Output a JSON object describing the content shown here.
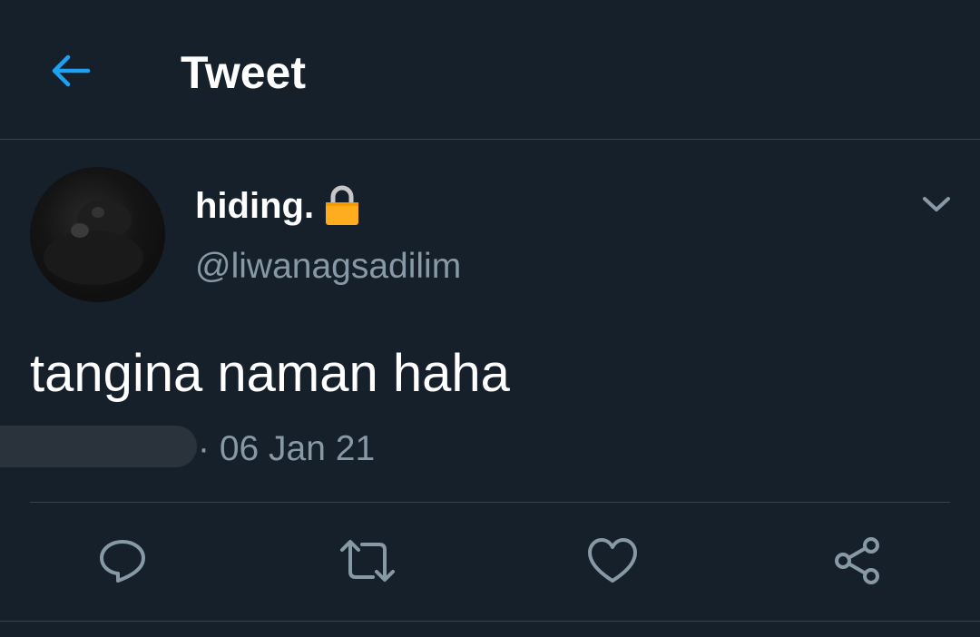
{
  "header": {
    "title": "Tweet",
    "back_icon": "arrow-left-icon"
  },
  "author": {
    "display_name": "hiding.",
    "handle": "@liwanagsadilim",
    "protected_icon": "lock-icon"
  },
  "tweet": {
    "text": "tangina naman haha",
    "timestamp": "· 06 Jan 21"
  },
  "actions": [
    {
      "name": "reply",
      "icon": "reply-icon"
    },
    {
      "name": "retweet",
      "icon": "retweet-icon"
    },
    {
      "name": "like",
      "icon": "heart-icon"
    },
    {
      "name": "share",
      "icon": "share-icon"
    }
  ],
  "colors": {
    "background": "#15202b",
    "accent": "#1da1f2",
    "secondary_text": "#8899a6",
    "divider": "#38444d",
    "lock": "#ffad1f"
  }
}
